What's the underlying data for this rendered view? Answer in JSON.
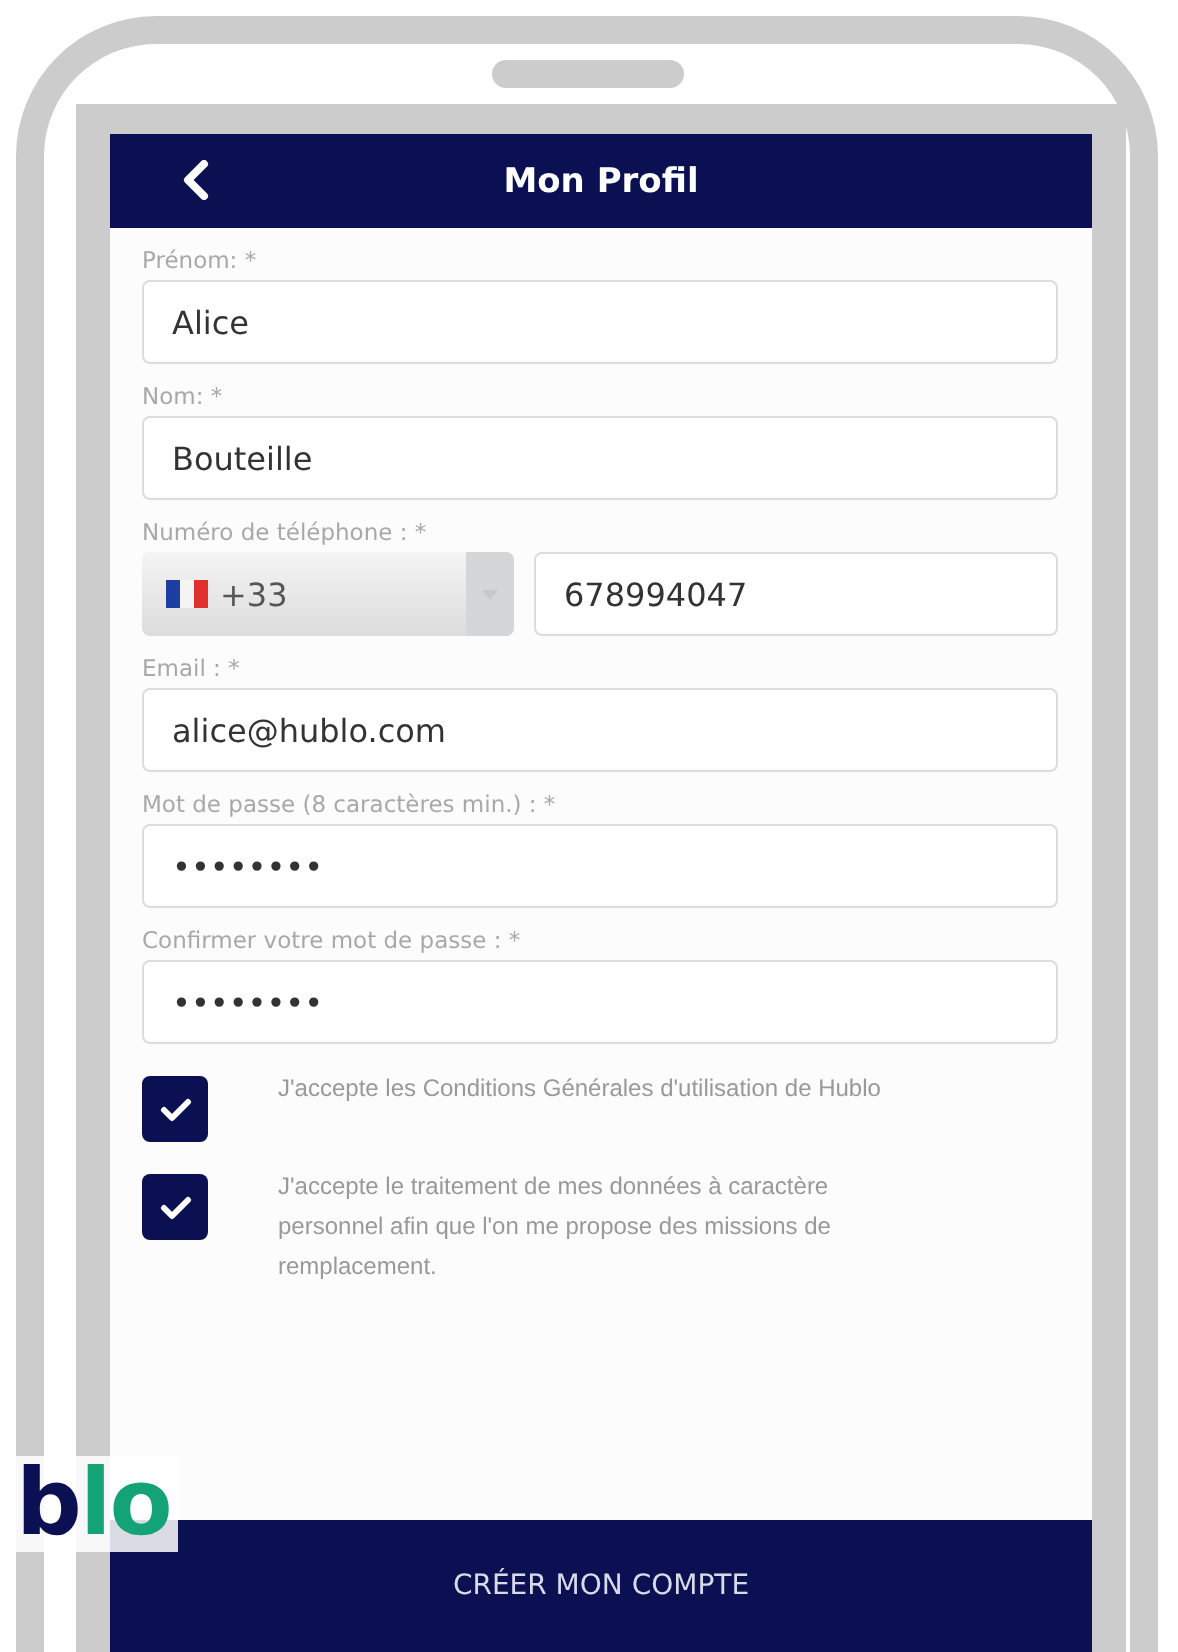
{
  "header": {
    "title": "Mon Profil"
  },
  "fields": [
    {
      "kind": "text",
      "label": "Prénom: *",
      "value": "Alice"
    },
    {
      "kind": "text",
      "label": "Nom: *",
      "value": "Bouteille"
    },
    {
      "kind": "phone",
      "label": "Numéro de téléphone : *",
      "code": "+33",
      "value": "678994047"
    },
    {
      "kind": "text",
      "label": "Email : *",
      "value": "alice@hublo.com"
    },
    {
      "kind": "text",
      "label": "Mot de passe (8 caractères min.) : *",
      "value": "••••••••"
    },
    {
      "kind": "text",
      "label": "Confirmer votre mot de passe : *",
      "value": "••••••••"
    }
  ],
  "consents": [
    {
      "text": "J'accepte les Conditions Générales d'utilisation de Hublo",
      "checked": true
    },
    {
      "text": "J'accepte le traitement de mes données à caractère personnel afin que l'on me propose des missions de remplacement.",
      "checked": true
    }
  ],
  "submit_button": "CRÉER MON COMPTE",
  "logo": {
    "dark_part": "b",
    "accent_part": "lo"
  }
}
